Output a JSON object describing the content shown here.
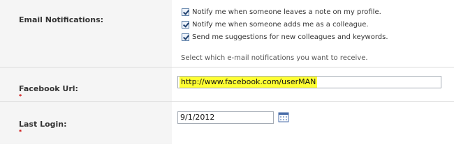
{
  "email_notifications": {
    "label": "Email Notifications:",
    "options": [
      {
        "label": "Notify me when someone leaves a note on my profile.",
        "checked": true
      },
      {
        "label": "Notify me when someone adds me as a colleague.",
        "checked": true
      },
      {
        "label": "Send me suggestions for new colleagues and keywords.",
        "checked": true
      }
    ],
    "hint": "Select which e-mail notifications you want to receive."
  },
  "facebook_url": {
    "label": "Facebook Url:",
    "required_marker": "*",
    "value": "http://www.facebook.com/userMAN",
    "highlight_color": "#ffff33"
  },
  "last_login": {
    "label": "Last Login:",
    "required_marker": "*",
    "value": "9/1/2012",
    "picker_icon": "calendar-icon"
  }
}
